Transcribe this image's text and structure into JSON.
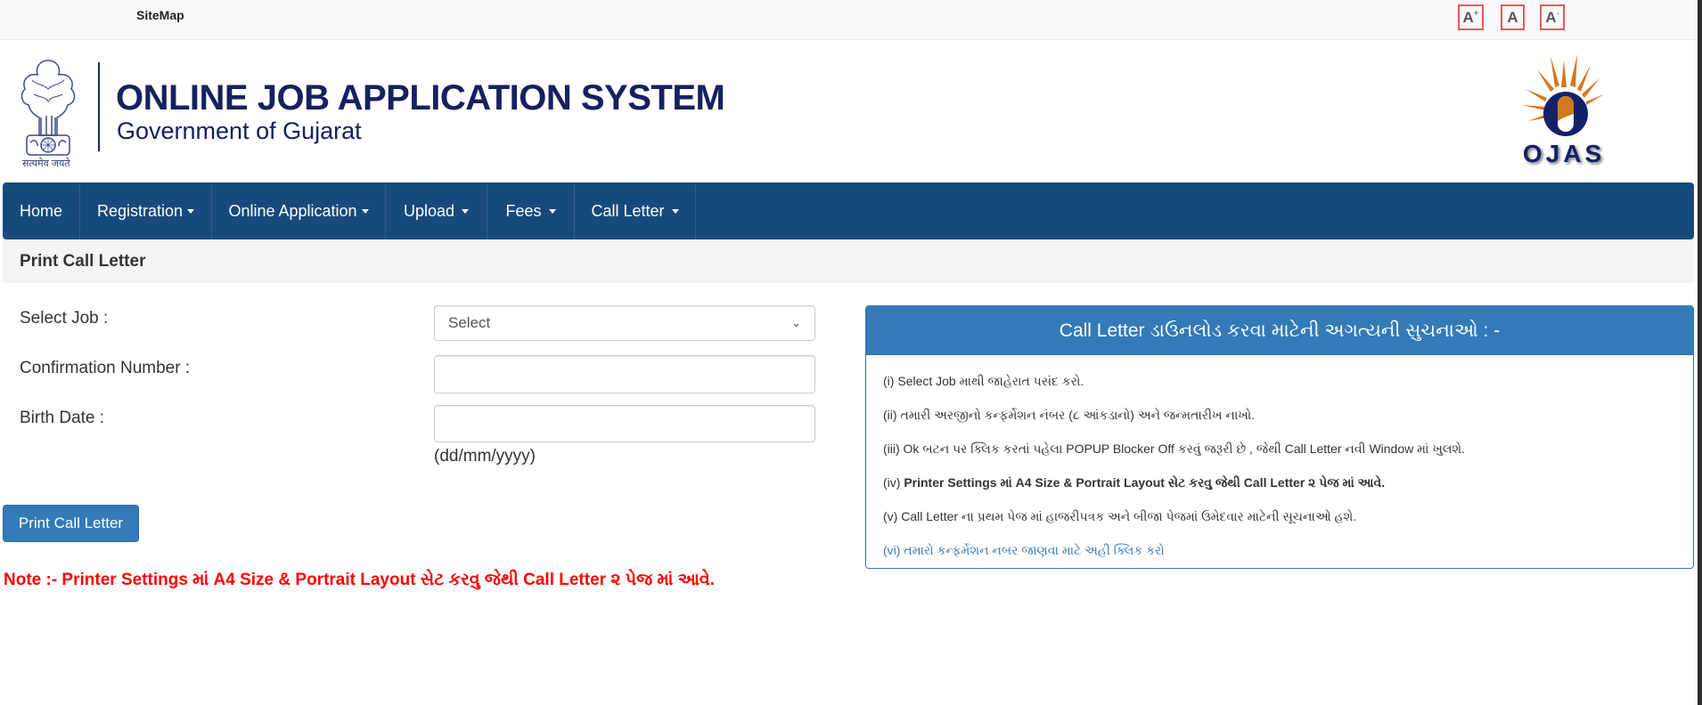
{
  "topbar": {
    "sitemap_label": "SiteMap",
    "font_increase": {
      "label": "A",
      "sup": "+"
    },
    "font_normal": {
      "label": "A"
    },
    "font_decrease": {
      "label": "A",
      "sup": "-"
    }
  },
  "header": {
    "emblem_caption": "सत्यमेव जयते",
    "title": "ONLINE JOB APPLICATION SYSTEM",
    "subtitle": "Government of Gujarat",
    "logo_text": "OJAS",
    "colors": {
      "navy": "#152160",
      "orange": "#d4781c"
    }
  },
  "nav": {
    "items": [
      {
        "label": "Home",
        "dropdown": false
      },
      {
        "label": "Registration",
        "dropdown": true
      },
      {
        "label": "Online Application",
        "dropdown": true
      },
      {
        "label": "Upload",
        "dropdown": true
      },
      {
        "label": "Fees",
        "dropdown": true
      },
      {
        "label": "Call Letter",
        "dropdown": true
      }
    ],
    "bg_color": "#174a7c"
  },
  "page": {
    "title": "Print Call Letter"
  },
  "form": {
    "select_job": {
      "label": "Select Job :",
      "value": "Select"
    },
    "confirmation": {
      "label": "Confirmation Number :",
      "value": ""
    },
    "birth_date": {
      "label": "Birth Date :",
      "value": "",
      "hint": "(dd/mm/yyyy)"
    },
    "submit_label": "Print Call Letter"
  },
  "note": "Note :- Printer Settings માં A4 Size & Portrait Layout સેટ કરવુ જેથી Call Letter ૨ પેજ માં આવે.",
  "instructions": {
    "title": "Call Letter ડાઉનલોડ કરવા માટેની અગત્યની સુચનાઓ : -",
    "items": [
      {
        "prefix": "(i)",
        "text": "Select Job માથી જાહેરાત પસંદ કરો."
      },
      {
        "prefix": "(ii)",
        "text": "તમારી અરજીનો કન્ફર્મેશન નંબર (૮ આંકડાનો) અને જન્મતારીખ નાખો."
      },
      {
        "prefix": "(iii)",
        "text": "Ok બટન પર ક્લિક કરતાં પહેલા POPUP Blocker Off કરવું જરૂરી છે , જેથી Call Letter નવી Window માં ખુલશે."
      },
      {
        "prefix": "(iv)",
        "text": "Printer Settings માં A4 Size & Portrait Layout સેટ કરવુ જેથી Call Letter ૨ પેજ માં આવે."
      },
      {
        "prefix": "(v)",
        "text": "Call Letter ના પ્રથમ પેજ માં હાજરીપત્રક અને બીજા પેજમાં ઉમેદવાર માટેની સૂચનાઓ હશે."
      },
      {
        "prefix": "(vi)",
        "text": "તમારો કન્ફર્મેશન નબર જાણવા માટે અહી ક્લિક કરો"
      }
    ],
    "header_color": "#337ab7"
  }
}
